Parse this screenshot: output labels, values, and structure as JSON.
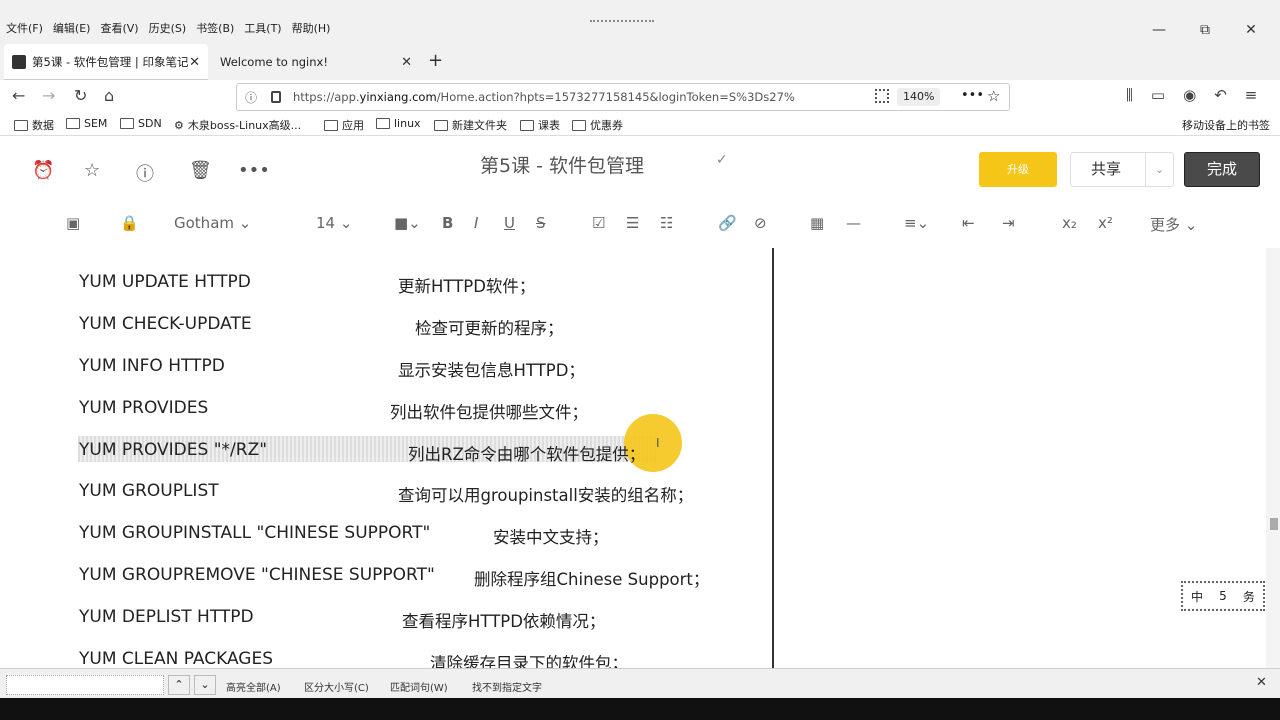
{
  "menubar": {
    "menus": [
      "文件(F)",
      "编辑(E)",
      "查看(V)",
      "历史(S)",
      "书签(B)",
      "工具(T)",
      "帮助(H)"
    ],
    "window_controls": [
      "—",
      "⧉",
      "✕"
    ]
  },
  "tabs": [
    {
      "label": "第5课 - 软件包管理 | 印象笔记",
      "active": true
    },
    {
      "label": "Welcome to nginx!",
      "active": false
    }
  ],
  "address": {
    "url_prefix": "https://app.",
    "url_domain": "yinxiang.com",
    "url_rest": "/Home.action?hpts=1573277158145&loginToken=S%3Ds27%",
    "zoom": "140%"
  },
  "bookmarks": [
    "数据",
    "SEM",
    "SDN",
    "木泉boss-Linux高级...",
    "应用",
    "linux",
    "新建文件夹",
    "课表",
    "优惠券"
  ],
  "bookmarks_mobile": "移动设备上的书签",
  "note": {
    "title": "第5课 - 软件包管理",
    "upgrade_label": "升级",
    "share_label": "共享",
    "done_label": "完成"
  },
  "format": {
    "font": "Gotham",
    "size": "14",
    "more": "更多"
  },
  "rows": [
    {
      "cmd": "YUM UPDATE    HTTPD",
      "desc": "更新HTTPD软件；"
    },
    {
      "cmd": "YUM CHECK-UPDATE",
      "desc": "检查可更新的程序；"
    },
    {
      "cmd": "YUM INFO      HTTPD",
      "desc": "显示安装包信息HTTPD；"
    },
    {
      "cmd": "YUM PROVIDES",
      "desc": "列出软件包提供哪些文件；"
    },
    {
      "cmd": "YUM PROVIDES \"*/RZ\"",
      "desc": "列出RZ命令由哪个软件包提供；"
    },
    {
      "cmd": "YUM GROUPLIST",
      "desc": "查询可以用groupinstall安装的组名称；"
    },
    {
      "cmd": "YUM GROUPINSTALL \"CHINESE SUPPORT\"",
      "desc": "安装中文支持；"
    },
    {
      "cmd": "YUM GROUPREMOVE \"CHINESE SUPPORT\"",
      "desc": "删除程序组Chinese Support；"
    },
    {
      "cmd": "YUM DEPLIST HTTPD",
      "desc": "查看程序HTTPD依赖情况；"
    },
    {
      "cmd": "YUM CLEAN      PACKAGES",
      "desc": "清除缓存目录下的软件包；"
    }
  ],
  "stamp": [
    "中",
    "5",
    "务"
  ],
  "findbar": {
    "options": [
      "高亮全部(A)",
      "区分大小写(C)",
      "匹配词句(W)",
      "找不到指定文字"
    ]
  }
}
